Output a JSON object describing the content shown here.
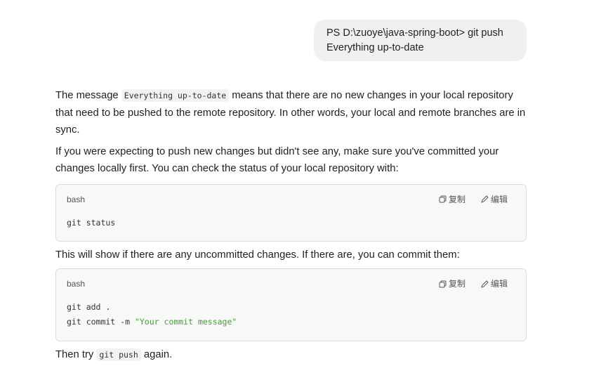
{
  "user_message": {
    "line1": "PS D:\\zuoye\\java-spring-boot> git push",
    "line2": "Everything up-to-date"
  },
  "answer": {
    "p1_before": "The message ",
    "p1_code": "Everything up-to-date",
    "p1_after": " means that there are no new changes in your local repository that need to be pushed to the remote repository. In other words, your local and remote branches are in sync.",
    "p2": "If you were expecting to push new changes but didn't see any, make sure you've committed your changes locally first. You can check the status of your local repository with:",
    "code_block_1": {
      "lang": "bash",
      "copy_label": "复制",
      "edit_label": "编辑",
      "line1": "git status"
    },
    "p3": "This will show if there are any uncommitted changes. If there are, you can commit them:",
    "code_block_2": {
      "lang": "bash",
      "copy_label": "复制",
      "edit_label": "编辑",
      "line1": "git add .",
      "line2_cmd": "git commit -m ",
      "line2_str": "\"Your commit message\""
    },
    "p4_before": "Then try ",
    "p4_code": "git push",
    "p4_after": " again."
  }
}
